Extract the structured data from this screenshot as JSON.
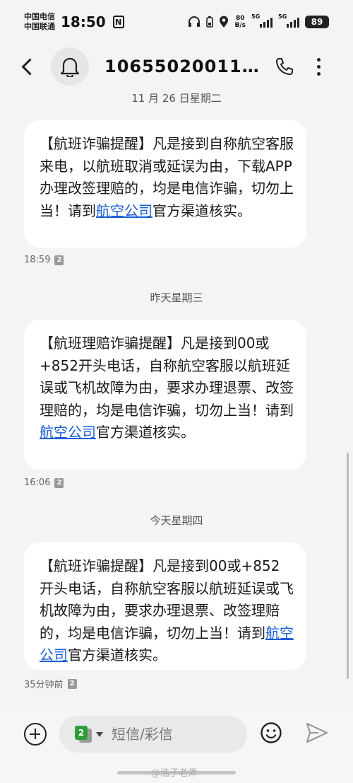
{
  "status_bar": {
    "carrier_1": "中国电信",
    "carrier_2": "中国联通",
    "time": "18:50",
    "nfc_label": "N",
    "net_speed_value": "80",
    "net_speed_unit": "B/s",
    "signal_1_label": "5G",
    "signal_2_label": "5G",
    "battery": "89"
  },
  "header": {
    "contact_number": "106550200110..."
  },
  "conversation": {
    "date_1": "11 月 26 日星期二",
    "msg_1": {
      "text_before": "【航班诈骗提醒】凡是接到自称航空客服来电，以航班取消或延误为由，下载APP办理改签理赔的，均是电信诈骗，切勿上当！请到",
      "link": "航空公司",
      "text_after": "官方渠道核实。",
      "time": "18:59",
      "sim": "2"
    },
    "date_2": "昨天星期三",
    "msg_2": {
      "text_before": "【航班理赔诈骗提醒】凡是接到00或+852开头电话，自称航空客服以航班延误或飞机故障为由，要求办理退票、改签理赔的，均是电信诈骗，切勿上当！请到",
      "link": "航空公司",
      "text_after": "官方渠道核实。",
      "time": "16:06",
      "sim": "2"
    },
    "date_3": "今天星期四",
    "msg_3": {
      "text_before": "【航班诈骗提醒】凡是接到00或+852开头电话，自称航空客服以航班延误或飞机故障为由，要求办理退票、改签理赔的，均是电信诈骗，切勿上当！请到",
      "link": "航空公司",
      "text_after": "官方渠道核实。",
      "time": "35分钟前",
      "sim": "2"
    }
  },
  "compose": {
    "placeholder": "短信/彩信",
    "sim_front": "2",
    "sim_back": "1",
    "sim_front_color": "#2e9d3c",
    "sim_back_color": "#9a9a9a"
  },
  "watermark": "@浩子老师",
  "colors": {
    "link": "#1a5fd6",
    "bubble": "#ffffff",
    "background": "#f4f4f4"
  }
}
